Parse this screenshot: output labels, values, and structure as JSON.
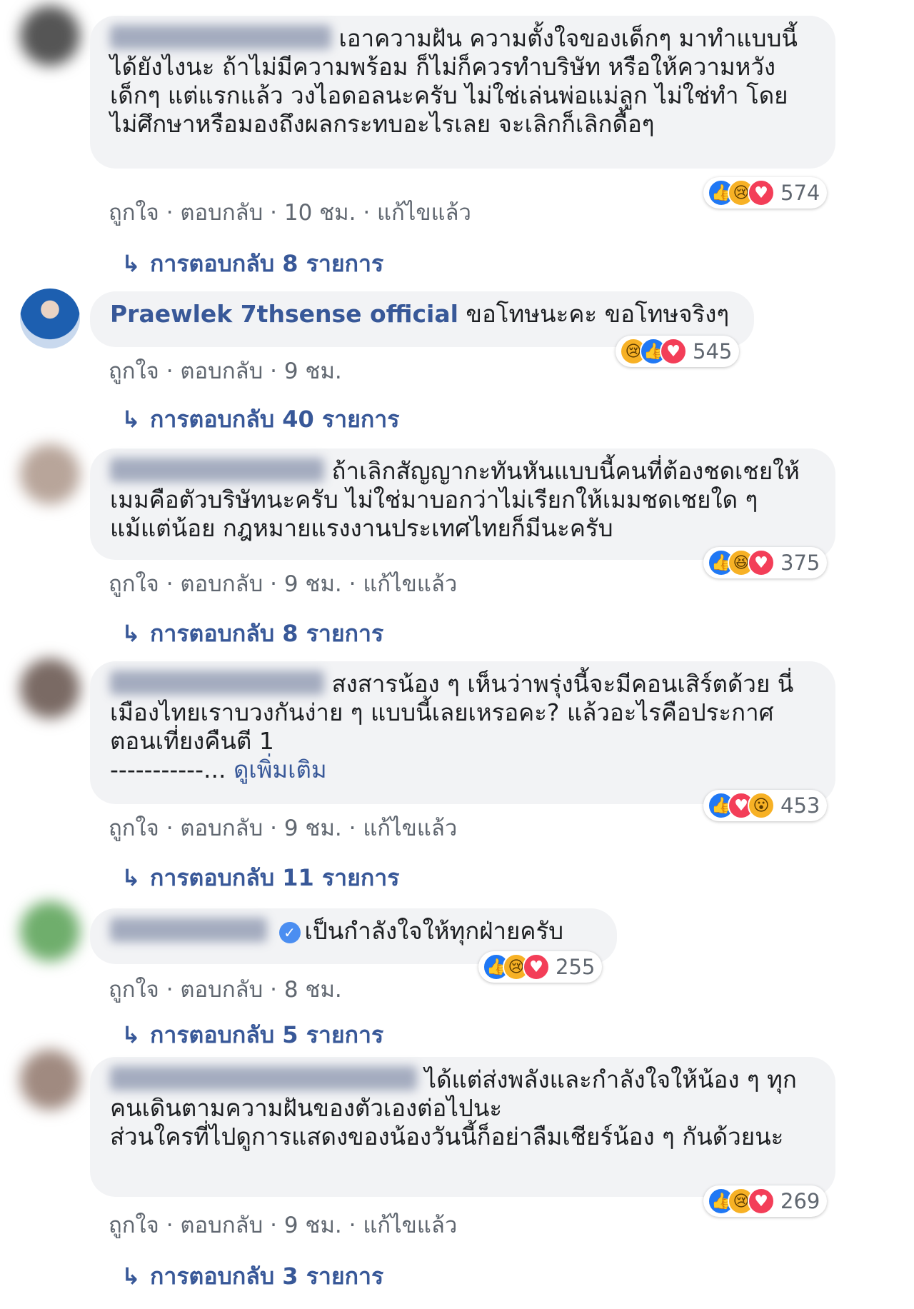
{
  "ui": {
    "like": "ถูกใจ",
    "reply": "ตอบกลับ",
    "edited": "แก้ไขแล้ว",
    "sep": " · ",
    "arrow": "↳"
  },
  "comments": [
    {
      "text": "เอาความฝัน ความตั้งใจของเด็กๆ มาทำแบบนี้ได้ยังไงนะ ถ้าไม่มีความพร้อม ก็ไม่ก็ควรทำบริษัท หรือให้ความหวังเด็กๆ แต่แรกแล้ว วงไอดอลนะครับ ไม่ใช่เล่นพ่อแม่ลูก ไม่ใช่ทำ โดยไม่ศึกษาหรือมองถึงผลกระทบอะไรเลย จะเลิกก็เลิกดื้อๆ",
      "time": "10 ชม.",
      "edited": true,
      "reaction_count": "574",
      "reactions": [
        "like-icon",
        "sad-icon",
        "love-icon"
      ],
      "replies": "การตอบกลับ 8 รายการ"
    },
    {
      "name": "Praewlek 7thsense official",
      "text": "ขอโทษนะคะ ขอโทษจริงๆ",
      "time": "9 ชม.",
      "edited": false,
      "reaction_count": "545",
      "reactions": [
        "sad-icon",
        "like-icon",
        "love-icon"
      ],
      "replies": "การตอบกลับ 40 รายการ"
    },
    {
      "text": "ถ้าเลิกสัญญากะทันหันแบบนี้คนที่ต้องชดเชยให้เมมคือตัวบริษัทนะครับ ไม่ใช่มาบอกว่าไม่เรียกให้เมมชดเชยใด ๆ แม้แต่น้อย กฎหมายแรงงานประเทศไทยก็มีนะครับ",
      "time": "9 ชม.",
      "edited": true,
      "reaction_count": "375",
      "reactions": [
        "like-icon",
        "haha-icon",
        "love-icon"
      ],
      "replies": "การตอบกลับ 8 รายการ"
    },
    {
      "text": "สงสารน้อง ๆ เห็นว่าพรุ่งนี้จะมีคอนเสิร์ตด้วย นี่เมืองไทยเราบวงกันง่าย ๆ แบบนี้เลยเหรอคะ? แล้วอะไรคือประกาศตอนเที่ยงคืนตี 1\n-----------...",
      "see_more": "ดูเพิ่มเติม",
      "time": "9 ชม.",
      "edited": true,
      "reaction_count": "453",
      "reactions": [
        "like-icon",
        "love-icon",
        "wow-icon"
      ],
      "replies": "การตอบกลับ 11 รายการ"
    },
    {
      "text": "เป็นกำลังใจให้ทุกฝ่ายครับ",
      "time": "8 ชม.",
      "edited": false,
      "reaction_count": "255",
      "reactions": [
        "like-icon",
        "sad-icon",
        "love-icon"
      ],
      "replies": "การตอบกลับ 5 รายการ"
    },
    {
      "text": "ได้แต่ส่งพลังและกำลังใจให้น้อง ๆ ทุกคนเดินตามความฝันของตัวเองต่อไปนะ\nส่วนใครที่ไปดูการแสดงของน้องวันนี้ก็อย่าลืมเชียร์น้อง ๆ กันด้วยนะ",
      "time": "9 ชม.",
      "edited": true,
      "reaction_count": "269",
      "reactions": [
        "like-icon",
        "sad-icon",
        "love-icon"
      ],
      "replies": "การตอบกลับ 3 รายการ"
    }
  ],
  "colors": {
    "link": "#385898",
    "bubble": "#f2f3f5",
    "like": "#2078f4",
    "love": "#f33e58",
    "emoji": "#f7b125"
  }
}
